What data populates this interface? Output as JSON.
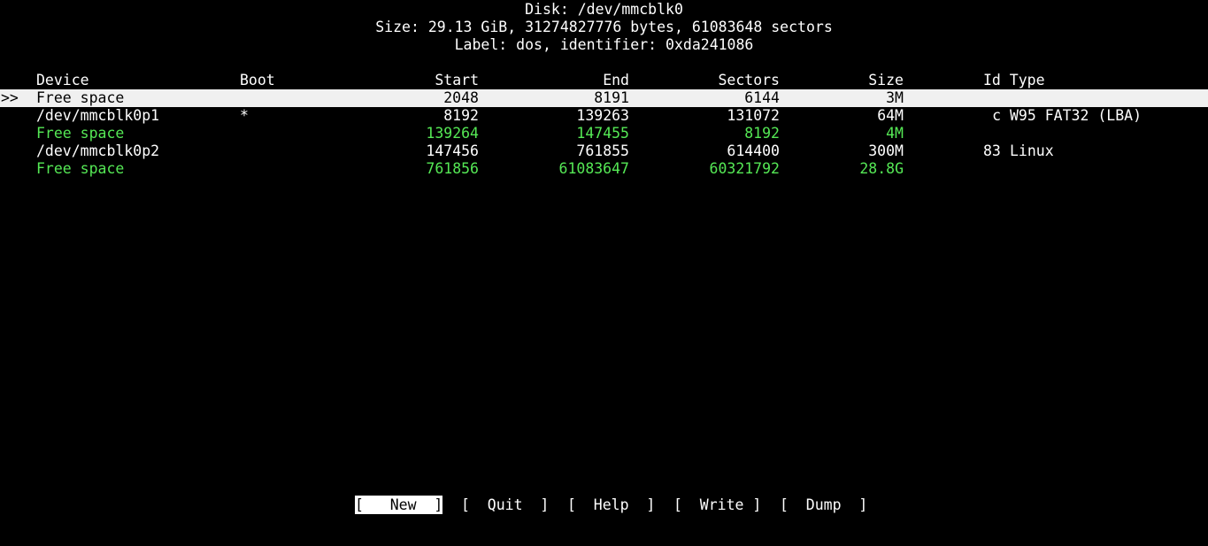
{
  "header": {
    "disk": "Disk: /dev/mmcblk0",
    "size": "Size: 29.13 GiB, 31274827776 bytes, 61083648 sectors",
    "label": "Label: dos, identifier: 0xda241086"
  },
  "table": {
    "columns": {
      "device": "Device",
      "boot": "Boot",
      "start": "Start",
      "end": "End",
      "sectors": "Sectors",
      "size": "Size",
      "idtype": "Id Type"
    },
    "cursor": ">>",
    "rows": [
      {
        "device": "Free space",
        "boot": "",
        "start": "2048",
        "end": "8191",
        "sectors": "6144",
        "size": "3M",
        "id": "",
        "type": ""
      },
      {
        "device": "/dev/mmcblk0p1",
        "boot": "*",
        "start": "8192",
        "end": "139263",
        "sectors": "131072",
        "size": "64M",
        "id": "c",
        "type": "W95 FAT32 (LBA)"
      },
      {
        "device": "Free space",
        "boot": "",
        "start": "139264",
        "end": "147455",
        "sectors": "8192",
        "size": "4M",
        "id": "",
        "type": ""
      },
      {
        "device": "/dev/mmcblk0p2",
        "boot": "",
        "start": "147456",
        "end": "761855",
        "sectors": "614400",
        "size": "300M",
        "id": "83",
        "type": "Linux"
      },
      {
        "device": "Free space",
        "boot": "",
        "start": "761856",
        "end": "61083647",
        "sectors": "60321792",
        "size": "28.8G",
        "id": "",
        "type": ""
      }
    ]
  },
  "menu": {
    "new": "[   New  ]",
    "quit": "[  Quit  ]",
    "help": "[  Help  ]",
    "write": "[  Write ]",
    "dump": "[  Dump  ]"
  },
  "colors": {
    "background": "#000000",
    "text": "#ffffff",
    "free_space": "#55e855",
    "selection": "#f0f0f0"
  }
}
